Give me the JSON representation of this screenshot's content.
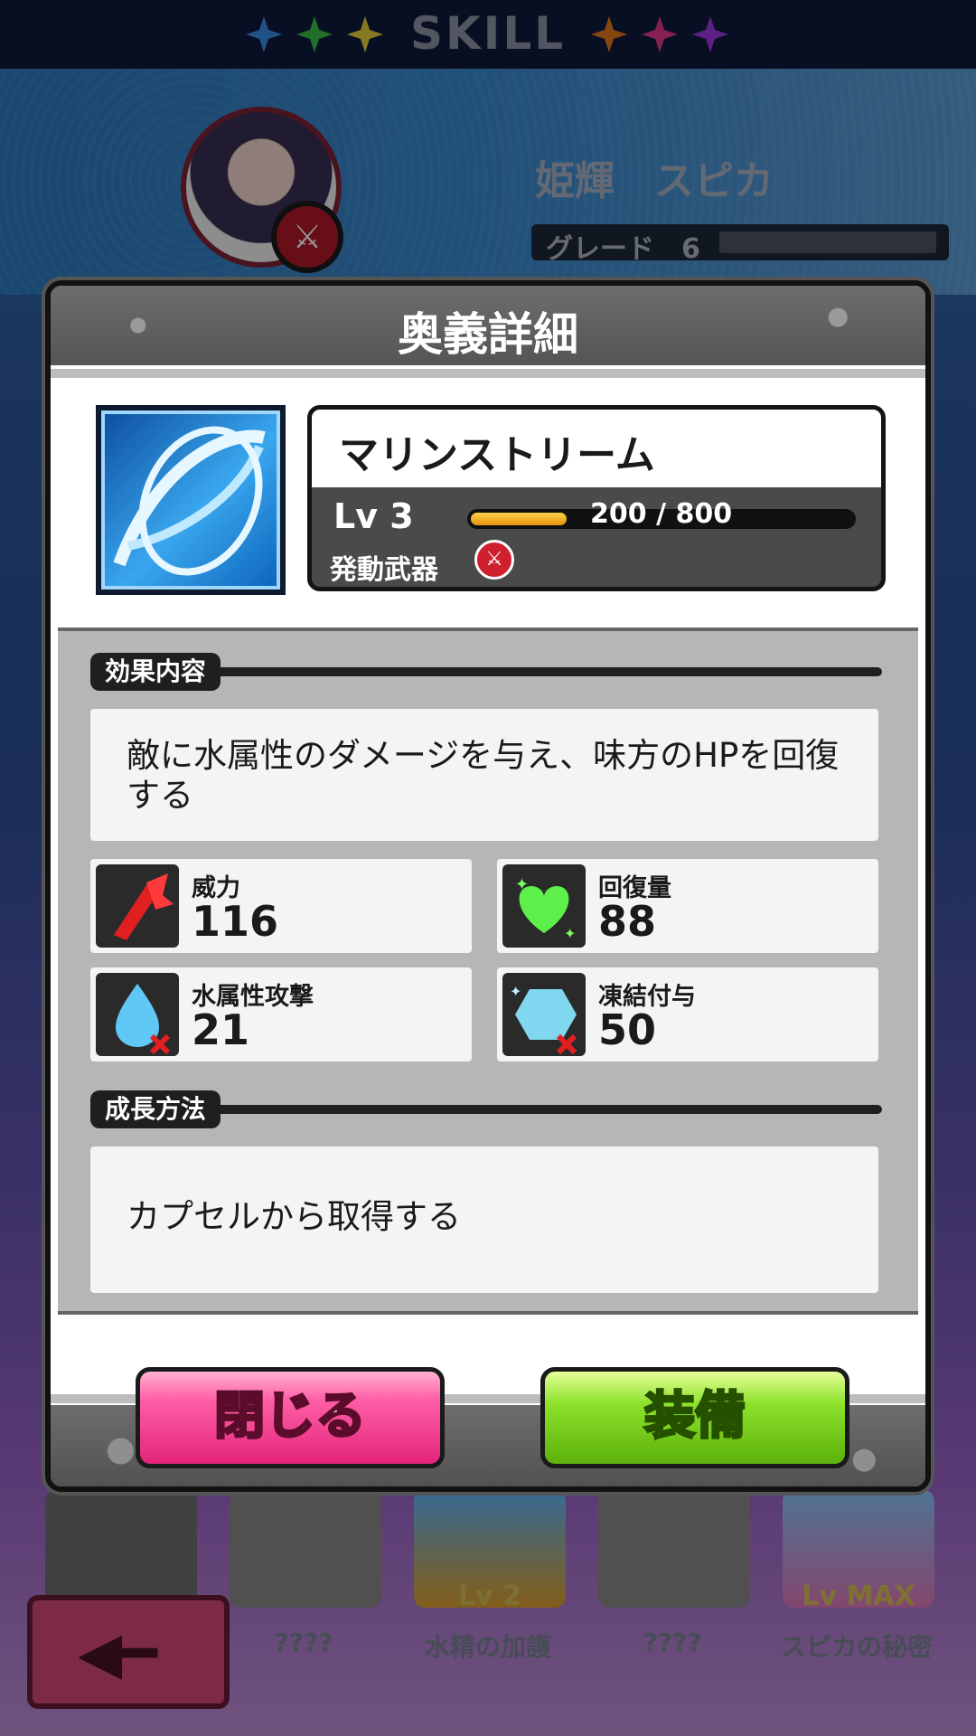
{
  "header": {
    "title": "SKILL"
  },
  "character": {
    "name": "姫輝　スピカ",
    "grade_label": "グレード　6"
  },
  "modal": {
    "title": "奥義詳細",
    "skill": {
      "name": "マリンストリーム",
      "level_label": "Lv 3",
      "xp_current": 200,
      "xp_max": 800,
      "xp_text": "200 / 800",
      "weapon_label": "発動武器"
    },
    "effect_section": {
      "title": "効果内容",
      "description": "敵に水属性のダメージを与え、味方のHPを回復する"
    },
    "stats": [
      {
        "label": "威力",
        "value": "116",
        "icon": "power-icon"
      },
      {
        "label": "回復量",
        "value": "88",
        "icon": "heal-heart-icon"
      },
      {
        "label": "水属性攻撃",
        "value": "21",
        "icon": "water-drop-icon"
      },
      {
        "label": "凍結付与",
        "value": "50",
        "icon": "freeze-crystal-icon"
      }
    ],
    "growth_section": {
      "title": "成長方法",
      "description": "カプセルから取得する"
    },
    "buttons": {
      "close": "閉じる",
      "equip": "装備"
    }
  },
  "background_tiles": [
    {
      "label": "????"
    },
    {
      "label": "水精の加護",
      "badge": "Lv 2"
    },
    {
      "label": "????"
    },
    {
      "label": "スピカの秘密",
      "badge": "Lv MAX"
    }
  ],
  "colors": {
    "close_button": "#ff5fa6",
    "equip_button": "#8de12b",
    "xp_fill": "#f0b020",
    "weapon_red": "#d02030"
  }
}
